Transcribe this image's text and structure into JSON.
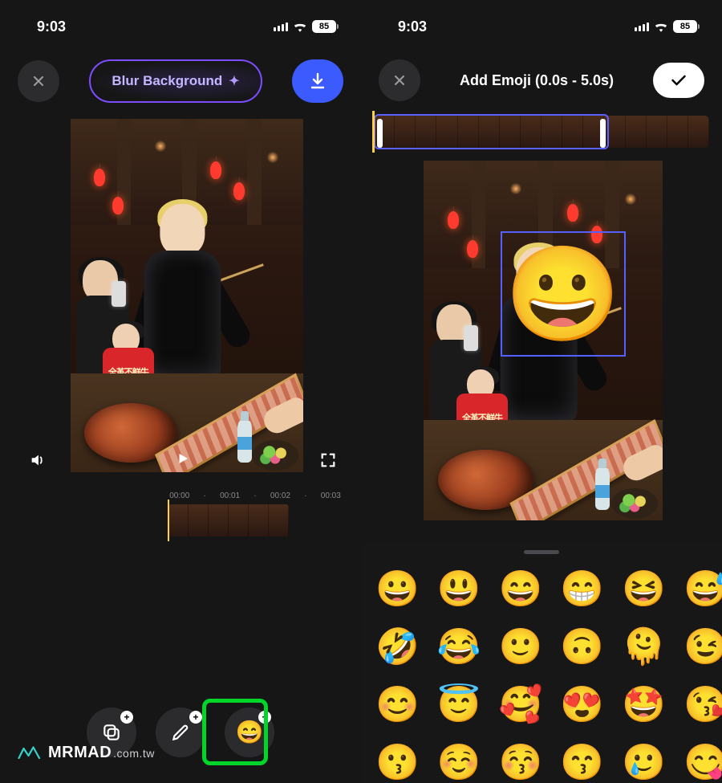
{
  "status": {
    "time": "9:03",
    "battery": "85"
  },
  "left": {
    "blur_label": "Blur Background",
    "kid_apron_text": "全革不鲜牛",
    "time_marks": [
      "00:00",
      "00:01",
      "00:02",
      "00:03"
    ],
    "tool_emoji": "😄"
  },
  "right": {
    "title": "Add Emoji (0.0s - 5.0s)",
    "overlay_emoji": "😀",
    "kid_apron_text": "全革不鲜牛",
    "emoji_grid": [
      "😀",
      "😃",
      "😄",
      "😁",
      "😆",
      "😅",
      "🤣",
      "😂",
      "🙂",
      "🙃",
      "🫠",
      "😉",
      "😊",
      "😇",
      "🥰",
      "😍",
      "🤩",
      "😘",
      "😗",
      "☺️",
      "😚",
      "😙",
      "🥲",
      "😋"
    ]
  },
  "watermark": {
    "main": "MRMAD",
    "sub": ".com.tw"
  }
}
